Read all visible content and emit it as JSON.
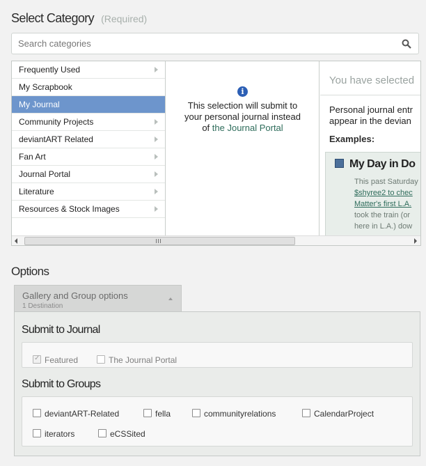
{
  "select_category": {
    "title": "Select Category",
    "required": "(Required)",
    "search_placeholder": "Search categories"
  },
  "categories": [
    {
      "label": "Frequently Used",
      "has_children": true
    },
    {
      "label": "My Scrapbook",
      "has_children": false
    },
    {
      "label": "My Journal",
      "has_children": false,
      "selected": true
    },
    {
      "label": "Community Projects",
      "has_children": true
    },
    {
      "label": "deviantART Related",
      "has_children": true
    },
    {
      "label": "Fan Art",
      "has_children": true
    },
    {
      "label": "Journal Portal",
      "has_children": true
    },
    {
      "label": "Literature",
      "has_children": true
    },
    {
      "label": "Resources & Stock Images",
      "has_children": true
    }
  ],
  "info_panel": {
    "line1": "This selection will submit to",
    "line2": "your personal journal instead",
    "line3_prefix": "of",
    "link": "the Journal Portal"
  },
  "selected_panel": {
    "title": "You have selected",
    "desc_line1": "Personal journal entr",
    "desc_line2": "appear in the devian",
    "examples": "Examples:",
    "example_title": "My Day in Do",
    "example_lines": [
      "This past Saturday",
      "$shyree2 to chec",
      "Matter's first L.A.",
      "took the train (or",
      "here in L.A.) dow"
    ]
  },
  "options": {
    "title": "Options",
    "gallery_tab_label": "Gallery and Group options",
    "gallery_tab_sub": "1 Destination",
    "submit_to_journal": "Submit to Journal",
    "journal_options": [
      {
        "label": "Featured",
        "checked": true,
        "disabled": true
      },
      {
        "label": "The Journal Portal",
        "checked": false,
        "disabled": true
      }
    ],
    "submit_to_groups": "Submit to Groups",
    "groups": [
      {
        "label": "deviantART-Related",
        "checked": false
      },
      {
        "label": "fella",
        "checked": false
      },
      {
        "label": "communityrelations",
        "checked": false
      },
      {
        "label": "CalendarProject",
        "checked": false
      },
      {
        "label": "iterators",
        "checked": false
      },
      {
        "label": "eCSSited",
        "checked": false
      }
    ]
  }
}
